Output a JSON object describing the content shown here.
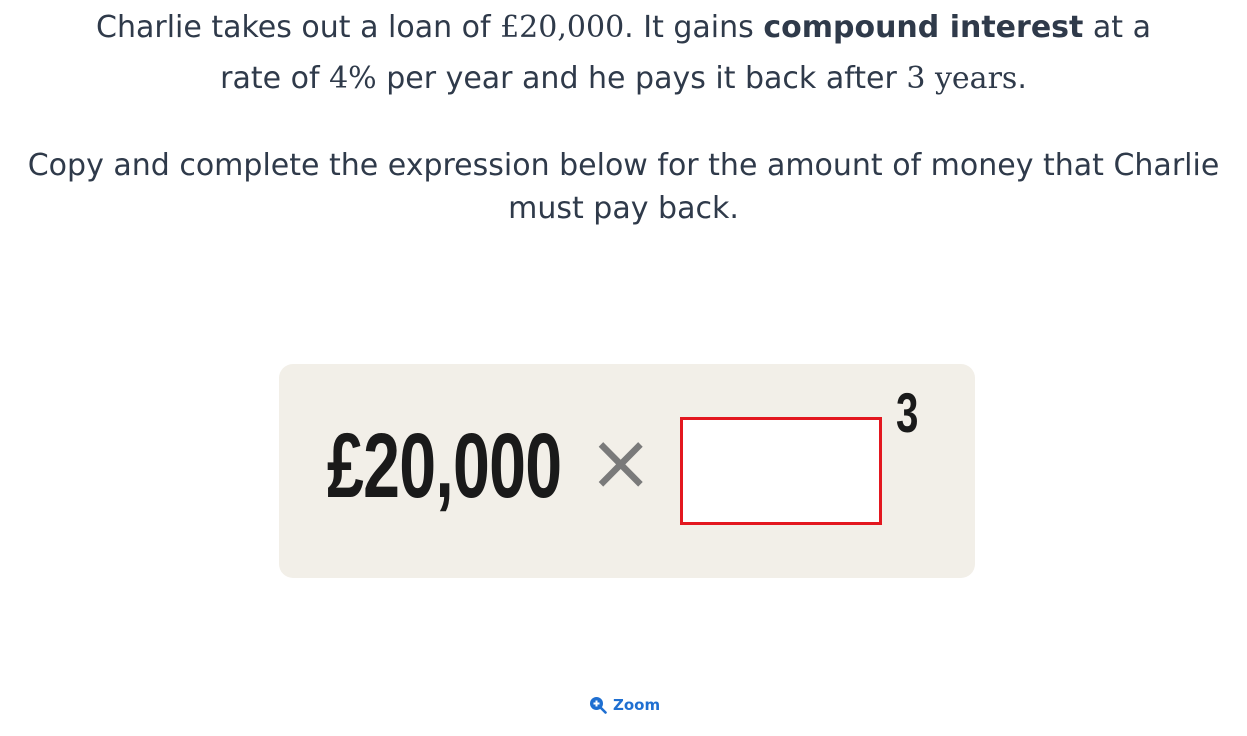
{
  "question": {
    "line1_pre": "Charlie takes out a loan of ",
    "loan_math": "£20,000",
    "line1_mid": ". It gains ",
    "bold_term": "compound interest",
    "line1_post": " at a",
    "line2_pre": "rate of ",
    "rate_math": "4%",
    "line2_mid": " per year and he pays it back after ",
    "years_math": "3 years",
    "line2_post": ".",
    "instruction": "Copy and complete the expression below for the amount of money that Charlie must pay back."
  },
  "expression": {
    "amount": "£20,000",
    "operator": "×",
    "exponent": "3"
  },
  "zoom_link": {
    "label": "Zoom",
    "icon": "zoom-in-icon",
    "color": "#1f6fd1"
  },
  "colors": {
    "card_background": "#f2efe8",
    "blank_border": "#e3171f"
  }
}
